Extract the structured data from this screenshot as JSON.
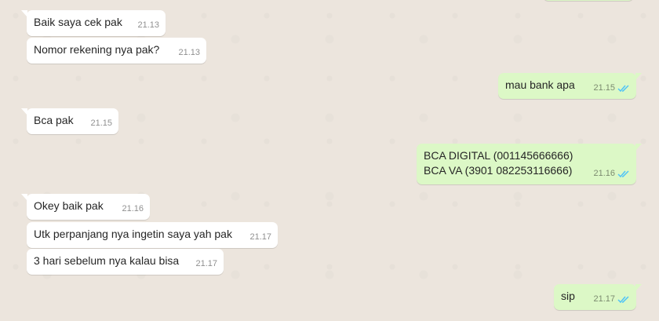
{
  "icons": {
    "read_receipt": "double-check-icon",
    "read_color": "#4fc3f7"
  },
  "colors": {
    "incoming": "#ffffff",
    "outgoing": "#dcf8c6",
    "background": "#ece5dd"
  },
  "messages": [
    {
      "direction": "out",
      "text": "",
      "time": ""
    },
    {
      "direction": "in",
      "text": "Baik saya cek pak",
      "time": "21.13"
    },
    {
      "direction": "in",
      "text": "Nomor rekening nya pak?",
      "time": "21.13"
    },
    {
      "direction": "out",
      "text": "mau bank apa",
      "time": "21.15",
      "status": "read"
    },
    {
      "direction": "in",
      "text": "Bca pak",
      "time": "21.15"
    },
    {
      "direction": "out",
      "text": "BCA DIGITAL (001145666666)\nBCA VA (3901 082253116666)",
      "time": "21.16",
      "status": "read"
    },
    {
      "direction": "in",
      "text": "Okey baik pak",
      "time": "21.16"
    },
    {
      "direction": "in",
      "text": "Utk perpanjang nya ingetin saya yah pak",
      "time": "21.17"
    },
    {
      "direction": "in",
      "text": "3 hari sebelum nya kalau bisa",
      "time": "21.17"
    },
    {
      "direction": "out",
      "text": "sip",
      "time": "21.17",
      "status": "read"
    }
  ]
}
